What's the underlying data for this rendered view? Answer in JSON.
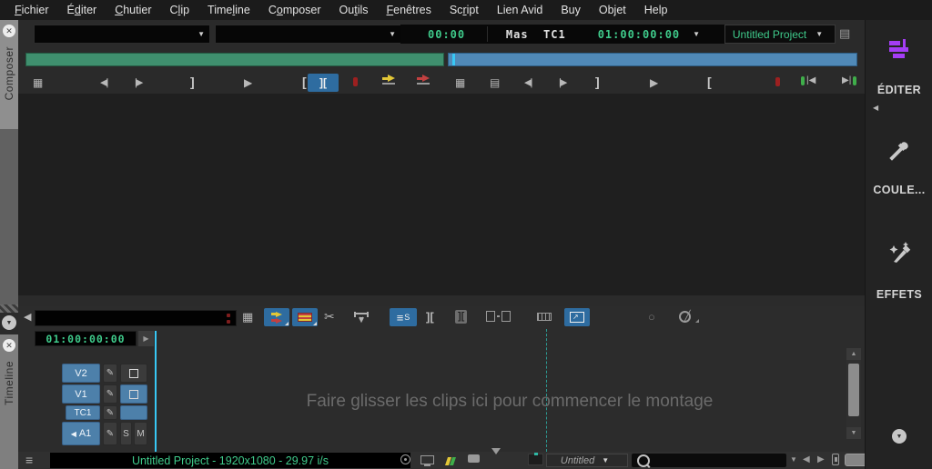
{
  "menu": {
    "items": [
      {
        "label": "Fichier",
        "u": 0
      },
      {
        "label": "Éditer",
        "u": 1
      },
      {
        "label": "Chutier",
        "u": 0
      },
      {
        "label": "Clip",
        "u": 1
      },
      {
        "label": "Timeline",
        "u": 4
      },
      {
        "label": "Composer",
        "u": 1
      },
      {
        "label": "Outils",
        "u": 2
      },
      {
        "label": "Fenêtres",
        "u": 0
      },
      {
        "label": "Script",
        "u": 2
      },
      {
        "label": "Lien Avid",
        "u": -1
      },
      {
        "label": "Buy",
        "u": -1
      },
      {
        "label": "Objet",
        "u": -1
      },
      {
        "label": "Help",
        "u": -1
      }
    ]
  },
  "left_rail": {
    "composer_tab": "Composer",
    "timeline_tab": "Timeline"
  },
  "composer_panel": {
    "source_timecode": "00:00",
    "timecode_track": "Mas  TC1",
    "record_timecode": "01:00:00:00",
    "project_selector": "Untitled Project"
  },
  "timeline_panel": {
    "timecode": "01:00:00:00",
    "tracks": [
      {
        "name": "V2"
      },
      {
        "name": "V1"
      },
      {
        "name": "TC1"
      },
      {
        "name": "A1"
      }
    ],
    "solo": "S",
    "mute": "M",
    "empty_message": "Faire glisser les clips ici pour commencer le montage",
    "status": "Untitled Project - 1920x1080 - 29.97 i/s",
    "bin_selector": "Untitled"
  },
  "right_sidebar": {
    "items": [
      {
        "label": "ÉDITER",
        "icon": "edit-workspace-icon"
      },
      {
        "label": "COULE...",
        "icon": "eyedropper-icon"
      },
      {
        "label": "EFFETS",
        "icon": "magic-wand-icon"
      }
    ]
  },
  "icons": {
    "close-icon": "✕",
    "dropdown-arrow-icon": "▼",
    "play-icon": "▶",
    "step-back-icon": "◀|",
    "step-forward-icon": "|▶",
    "mark-in-icon": "[",
    "mark-out-icon": "]",
    "scissors-icon": "✂",
    "pencil-icon": "✎",
    "speaker-icon": "◀",
    "menu-icon": "≡",
    "collapse-icon": "◀",
    "grid-icon": "▦",
    "film-icon": "▤",
    "circle-icon": "○",
    "splice-brackets-icon": "]["
  },
  "colors": {
    "timecode_green": "#3fcb8b",
    "position_bar_green": "#3f8f6e",
    "position_bar_blue": "#5089b7",
    "playhead_cyan": "#38c8f5",
    "button_highlight_blue": "#2e6ca0",
    "track_button_blue": "#4d80aa",
    "workspace_purple": "#a43df5",
    "marker_red": "#9c2020"
  }
}
